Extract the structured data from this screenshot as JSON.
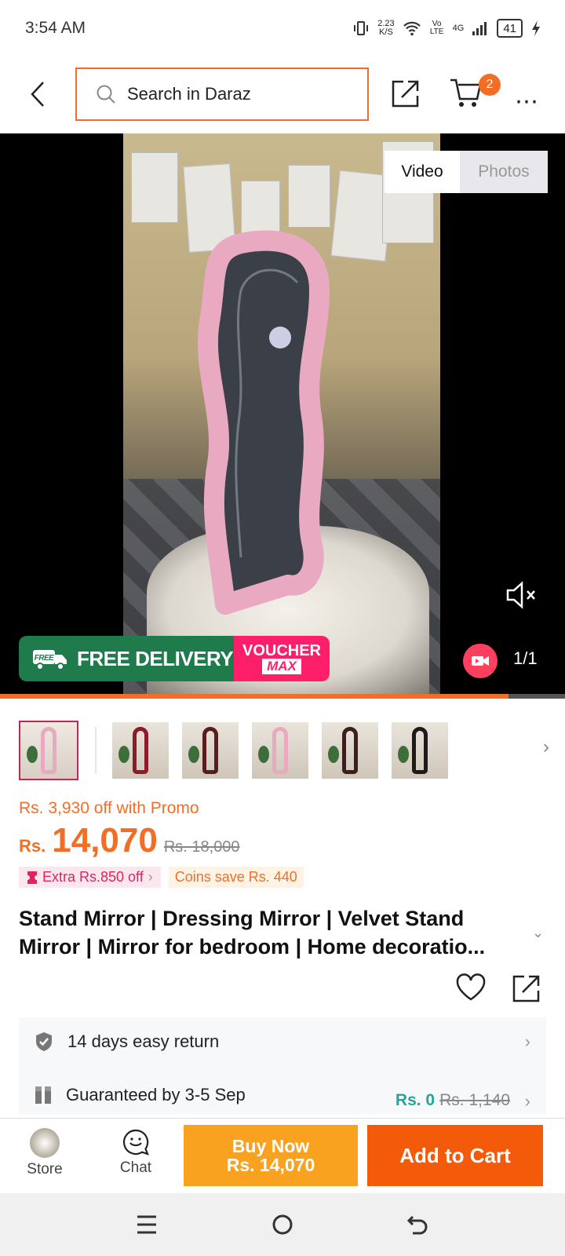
{
  "status": {
    "time": "3:54 AM",
    "speed_top": "2.23",
    "speed_bottom": "K/S",
    "volte": "Vo LTE",
    "network": "4G",
    "battery": "41"
  },
  "header": {
    "search_placeholder": "Search in Daraz",
    "cart_count": "2"
  },
  "media": {
    "tab_video": "Video",
    "tab_photos": "Photos",
    "delivery_label": "FREE DELIVERY",
    "truck_label": "FREE",
    "voucher_line1": "VOUCHER",
    "voucher_line2": "MAX",
    "counter": "1/1",
    "progress_fraction": 0.9
  },
  "product": {
    "promo_text": "Rs. 3,930 off with Promo",
    "currency": "Rs.",
    "price": "14,070",
    "old_price": "Rs. 18,000",
    "tag_extra": "Extra Rs.850 off",
    "tag_coins": "Coins save Rs. 440",
    "title": "Stand Mirror | Dressing Mirror | Velvet Stand Mirror | Mirror for bedroom | Home decoratio..."
  },
  "services": {
    "return_text": "14 days easy return",
    "guarantee_text": "Guaranteed by 3-5 Sep",
    "delivery_price": "Rs. 0",
    "delivery_old": "Rs. 1,140"
  },
  "bottom": {
    "store_label": "Store",
    "chat_label": "Chat",
    "buy_line1": "Buy Now",
    "buy_line2": "Rs. 14,070",
    "add_to_cart": "Add to Cart"
  },
  "colors": {
    "accent": "#f36e24",
    "buy": "#f9a21f",
    "cart": "#f35b0b",
    "delivery_green": "#1f7a4c",
    "voucher_pink": "#ff1e6a"
  }
}
